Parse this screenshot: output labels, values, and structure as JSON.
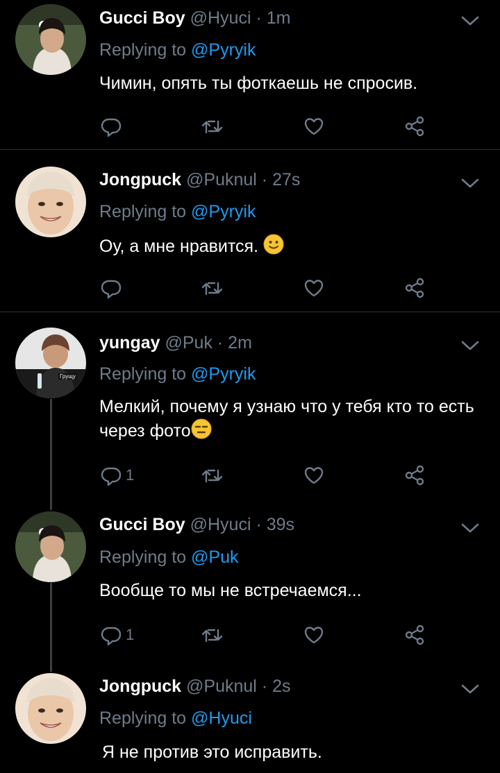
{
  "tweets": [
    {
      "name": "Gucci Boy",
      "handle": "@Hyuci",
      "time": "1m",
      "replying_prefix": "Replying to ",
      "replying_to": "@Pyryik",
      "text": "Чимин, опять ты фоткаешь не спросив.",
      "reply_count": "",
      "avatar": "avatar-gucci-boy"
    },
    {
      "name": "Jongpuck",
      "handle": "@Puknul",
      "time": "27s",
      "replying_prefix": "Replying to ",
      "replying_to": "@Pyryik",
      "text": "Оу, а мне нравится.",
      "reply_count": "",
      "avatar": "avatar-jongpuck"
    },
    {
      "name": "yungay",
      "handle": "@Puk",
      "time": "2m",
      "replying_prefix": "Replying to ",
      "replying_to": "@Pyryik",
      "text": "Мелкий, почему я узнаю что у тебя кто то есть через фото",
      "reply_count": "1",
      "avatar": "avatar-yungay",
      "avatar_caption": "Грущу"
    },
    {
      "name": "Gucci Boy",
      "handle": "@Hyuci",
      "time": "39s",
      "replying_prefix": "Replying to ",
      "replying_to": "@Puk",
      "text": "Вообще то мы не встречаемся...",
      "reply_count": "1",
      "avatar": "avatar-gucci-boy"
    },
    {
      "name": "Jongpuck",
      "handle": "@Puknul",
      "time": "2s",
      "replying_prefix": "Replying to ",
      "replying_to": "@Hyuci",
      "text": "Я не против это исправить.",
      "reply_count": "",
      "avatar": "avatar-jongpuck"
    }
  ],
  "dot": " · ",
  "icons": [
    "reply-icon",
    "retweet-icon",
    "like-icon",
    "share-icon",
    "chevron-down-icon"
  ],
  "colors": {
    "background": "#000000",
    "muted": "#6e7c8a",
    "link": "#1d9bf0",
    "separator": "#2f3336"
  }
}
